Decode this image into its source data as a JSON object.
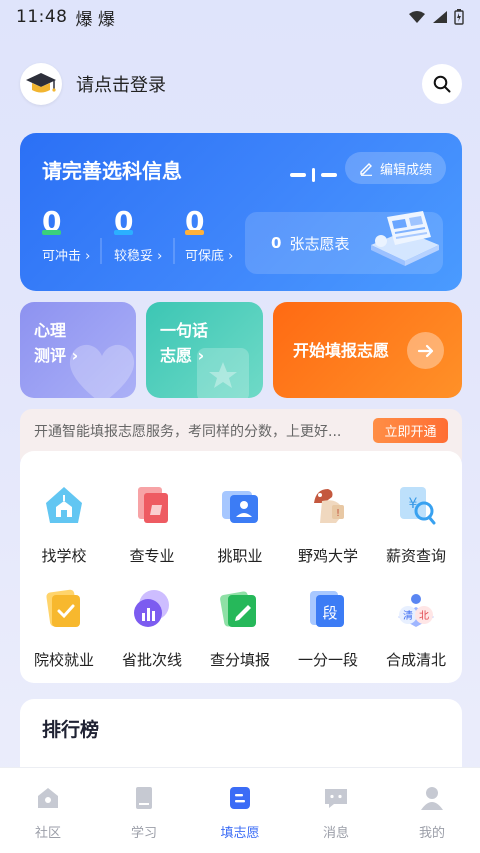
{
  "status_bar": {
    "time": "11:48",
    "app_badges": "爆 爆"
  },
  "header": {
    "login_text": "请点击登录"
  },
  "card": {
    "title": "请完善选科信息",
    "edit_label": "编辑成绩",
    "stats": [
      {
        "value": "0",
        "label": "可冲击 ›"
      },
      {
        "value": "0",
        "label": "较稳妥 ›"
      },
      {
        "value": "0",
        "label": "可保底 ›"
      }
    ],
    "volunteer_count": "0",
    "volunteer_label": "张志愿表"
  },
  "tiles": {
    "psych_line1": "心理",
    "psych_line2": "测评 ›",
    "phrase_line1": "一句话",
    "phrase_line2": "志愿 ›",
    "start_label": "开始填报志愿"
  },
  "promo": {
    "text": "开通智能填报志愿服务，考同样的分数，上更好...",
    "button": "立即开通"
  },
  "tools": [
    {
      "label": "找学校",
      "icon": "school-icon"
    },
    {
      "label": "查专业",
      "icon": "major-icon"
    },
    {
      "label": "挑职业",
      "icon": "career-icon"
    },
    {
      "label": "野鸡大学",
      "icon": "fake-university-icon"
    },
    {
      "label": "薪资查询",
      "icon": "salary-icon"
    },
    {
      "label": "院校就业",
      "icon": "employment-icon"
    },
    {
      "label": "省批次线",
      "icon": "batch-line-icon"
    },
    {
      "label": "查分填报",
      "icon": "score-check-icon"
    },
    {
      "label": "一分一段",
      "icon": "score-segment-icon"
    },
    {
      "label": "合成清北",
      "icon": "qingbei-icon"
    }
  ],
  "tool_icon_text": {
    "segment": "段",
    "qing": "清",
    "bei": "北"
  },
  "ranking": {
    "title": "排行榜"
  },
  "tabbar": [
    {
      "label": "社区",
      "icon": "community-icon",
      "active": false
    },
    {
      "label": "学习",
      "icon": "study-icon",
      "active": false
    },
    {
      "label": "填志愿",
      "icon": "volunteer-icon",
      "active": true
    },
    {
      "label": "消息",
      "icon": "message-icon",
      "active": false
    },
    {
      "label": "我的",
      "icon": "profile-icon",
      "active": false
    }
  ],
  "colors": {
    "primary": "#3b6cf6",
    "orange": "#ff7a1e",
    "teal": "#3cc6b4",
    "purple": "#8d92f0"
  }
}
